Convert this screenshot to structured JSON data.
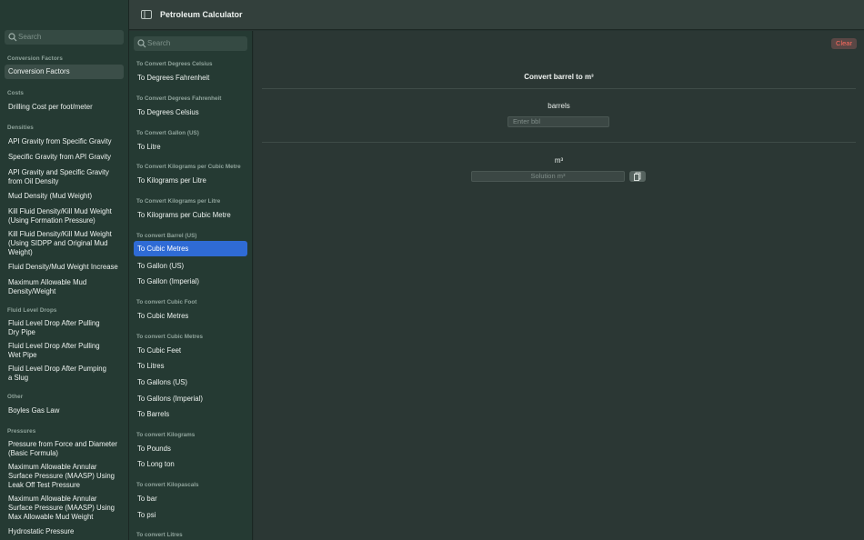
{
  "app": {
    "title": "Petroleum Calculator"
  },
  "sidebar": {
    "search_placeholder": "Search",
    "sections": [
      {
        "header": "Conversion Factors",
        "items": [
          "Conversion Factors"
        ]
      },
      {
        "header": "Costs",
        "items": [
          "Drilling Cost per foot/meter"
        ]
      },
      {
        "header": "Densities",
        "items": [
          "API Gravity from Specific Gravity",
          "Specific Gravity from API Gravity",
          "API Gravity and Specific Gravity from Oil Density",
          "Mud Density (Mud Weight)",
          "Kill Fluid Density/Kill Mud Weight (Using Formation Pressure)",
          "Kill Fluid Density/Kill Mud Weight (Using SIDPP and Original Mud Weight)",
          "Fluid Density/Mud Weight Increase",
          "Maximum Allowable Mud Density/Weight"
        ]
      },
      {
        "header": "Fluid Level Drops",
        "items": [
          "Fluid Level Drop After Pulling Dry Pipe",
          "Fluid Level Drop After Pulling Wet Pipe",
          "Fluid Level Drop After Pumping a Slug"
        ]
      },
      {
        "header": "Other",
        "items": [
          "Boyles Gas Law"
        ]
      },
      {
        "header": "Pressures",
        "items": [
          "Pressure from Force and Diameter (Basic Formula)",
          "Maximum Allowable Annular Surface Pressure (MAASP) Using Leak Off Test Pressure",
          "Maximum Allowable Annular Surface Pressure (MAASP) Using Max Allowable Mud Weight",
          "Hydrostatic Pressure"
        ]
      }
    ]
  },
  "list": {
    "search_placeholder": "Search",
    "sections": [
      {
        "header": "To Convert Degrees Celsius",
        "items": [
          "To Degrees Fahrenheit"
        ]
      },
      {
        "header": "To Convert Degrees Fahrenheit",
        "items": [
          "To Degrees Celsius"
        ]
      },
      {
        "header": "To Convert Gallon (US)",
        "items": [
          "To Litre"
        ]
      },
      {
        "header": "To Convert Kilograms per Cubic Metre",
        "items": [
          "To Kilograms per Litre"
        ]
      },
      {
        "header": "To Convert Kilograms per Litre",
        "items": [
          "To Kilograms per Cubic Metre"
        ]
      },
      {
        "header": "To convert Barrel (US)",
        "items": [
          "To Cubic Metres",
          "To Gallon (US)",
          "To Gallon (Imperial)"
        ]
      },
      {
        "header": "To convert Cubic Foot",
        "items": [
          "To Cubic Metres"
        ]
      },
      {
        "header": "To convert Cubic Metres",
        "items": [
          "To Cubic Feet",
          "To Litres",
          "To Gallons (US)",
          "To Gallons (Imperial)",
          "To Barrels"
        ]
      },
      {
        "header": "To convert Kilograms",
        "items": [
          "To Pounds",
          "To Long ton"
        ]
      },
      {
        "header": "To convert Kilopascals",
        "items": [
          "To bar",
          "To psi"
        ]
      },
      {
        "header": "To convert Litres",
        "items": []
      }
    ]
  },
  "detail": {
    "clear_label": "Clear",
    "heading": "Convert barrel to m³",
    "input_label": "barrels",
    "input_placeholder": "Enter bbl",
    "output_label": "m³",
    "output_placeholder": "Solution m³"
  },
  "colors": {
    "accent": "#2f6bd5",
    "destructive": "#ff6b5e",
    "sidebar_bg": "#253a33"
  }
}
